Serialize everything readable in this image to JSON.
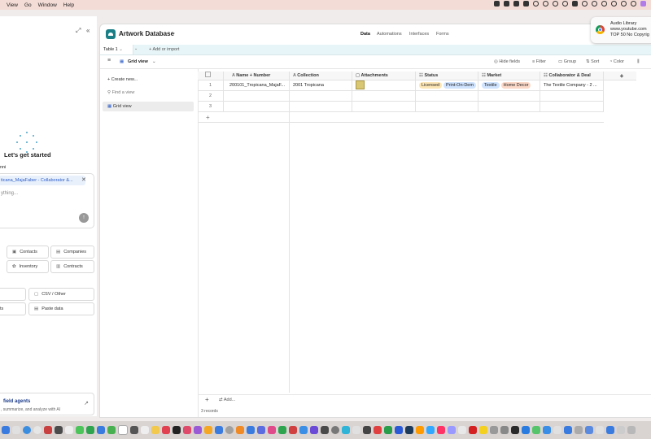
{
  "menubar": {
    "items": [
      "View",
      "Go",
      "Window",
      "Help"
    ]
  },
  "left_pane": {
    "heading": "Let's get started",
    "name_label": "nni",
    "chip": "ticana_MajaFaber - Collaborator &...",
    "placeholder": "ything...",
    "buttons_row1": [
      "Contacts",
      "Companies"
    ],
    "buttons_row2": [
      "Inventory",
      "Contracts"
    ],
    "buttons_row3": [
      "",
      "CSV / Other"
    ],
    "buttons_row4": [
      "ts",
      "Paste data"
    ],
    "agent_title": "field agents",
    "agent_sub": ", summarize, and analyze with AI"
  },
  "app": {
    "base_name": "Artwork Database",
    "nav_tabs": [
      "Data",
      "Automations",
      "Interfaces",
      "Forms"
    ],
    "table_tab": "Table 1",
    "add_import": "Add or import",
    "view_name": "Grid view",
    "toolbar": [
      "Hide fields",
      "Filter",
      "Group",
      "Sort",
      "Color"
    ],
    "sidebar": {
      "create": "Create new...",
      "find": "Find a view",
      "grid": "Grid view"
    },
    "columns": [
      "Name + Number",
      "Collection",
      "Attachments",
      "Status",
      "Market",
      "Collaborator & Deal"
    ],
    "rows": [
      {
        "num": "1",
        "name": "200101_Tropicana_MajaF...",
        "collection": "2001 Tropicana",
        "status": [
          "Licensed",
          "Print-On-Dem"
        ],
        "market": [
          "Textile",
          "Home Decor"
        ],
        "collab": "The Textile Company - 2 ..."
      },
      {
        "num": "2"
      },
      {
        "num": "3"
      }
    ],
    "add_label": "Add...",
    "records": "3 records"
  },
  "notification": {
    "title": "Audio Library",
    "line2": "www.youtube.com",
    "line3": "TOP 50 No Copyrig"
  },
  "colors": {
    "accent": "#1a7f86",
    "licensed": "#fde6b6",
    "print": "#cfe3ff",
    "textile": "#cfe3ff",
    "home": "#fbd8c8"
  }
}
